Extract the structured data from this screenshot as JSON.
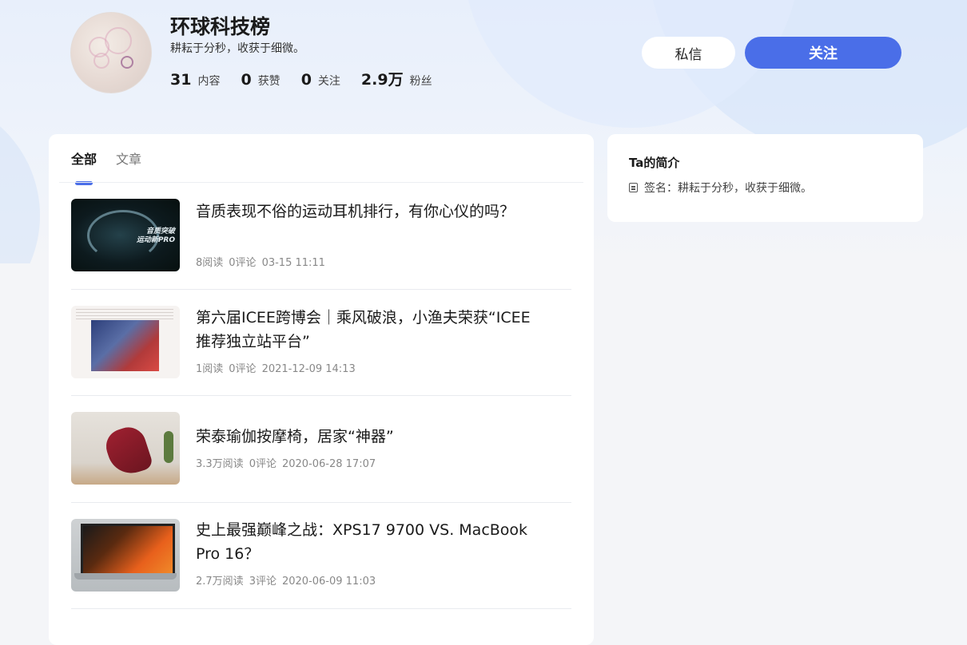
{
  "profile": {
    "name": "环球科技榜",
    "signature": "耕耘于分秒，收获于细微。",
    "stats": [
      {
        "num": "31",
        "label": "内容"
      },
      {
        "num": "0",
        "label": "获赞"
      },
      {
        "num": "0",
        "label": "关注"
      },
      {
        "num": "2.9万",
        "label": "粉丝"
      }
    ]
  },
  "actions": {
    "message_label": "私信",
    "follow_label": "关注"
  },
  "colors": {
    "accent": "#4a6ee8",
    "background": "#f4f5f8"
  },
  "tabs": [
    {
      "label": "全部",
      "active": true
    },
    {
      "label": "文章",
      "active": false
    }
  ],
  "articles": [
    {
      "title": "音质表现不俗的运动耳机排行，有你心仪的吗？",
      "reads": "8阅读",
      "comments": "0评论",
      "date": "03-15 11:11",
      "thumb_caption": "音质突破\n运动新PRO"
    },
    {
      "title": "第六届ICEE跨博会｜乘风破浪，小渔夫荣获“ICEE推荐独立站平台”",
      "reads": "1阅读",
      "comments": "0评论",
      "date": "2021-12-09 14:13"
    },
    {
      "title": "荣泰瑜伽按摩椅，居家“神器”",
      "reads": "3.3万阅读",
      "comments": "0评论",
      "date": "2020-06-28 17:07"
    },
    {
      "title": "史上最强巅峰之战：XPS17 9700 VS. MacBook Pro 16？",
      "reads": "2.7万阅读",
      "comments": "3评论",
      "date": "2020-06-09 11:03"
    }
  ],
  "intro": {
    "title": "Ta的简介",
    "signature_label": "签名：",
    "signature_value": "耕耘于分秒，收获于细微。",
    "icon": "doc-icon"
  }
}
